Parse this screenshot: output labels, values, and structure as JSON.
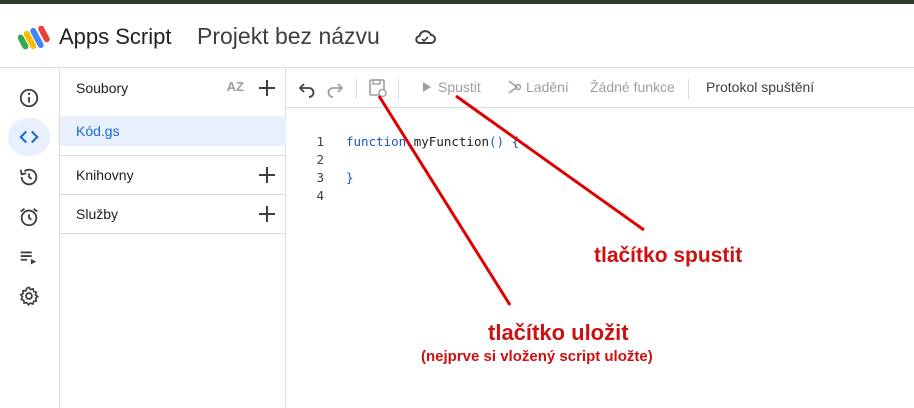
{
  "header": {
    "app_name": "Apps Script",
    "project_name": "Projekt bez názvu"
  },
  "files_panel": {
    "files_label": "Soubory",
    "sort_icon_text": "AZ",
    "file_name": "Kód.gs",
    "libraries_label": "Knihovny",
    "services_label": "Služby"
  },
  "toolbar": {
    "run_label": "Spustit",
    "debug_label": "Ladění",
    "function_select": "Žádné funkce",
    "execution_log_label": "Protokol spuštění"
  },
  "editor": {
    "line_numbers": [
      "1",
      "2",
      "3",
      "4"
    ],
    "keyword": "function",
    "function_name": "myFunction",
    "parens": "()",
    "open_brace": "{",
    "close_brace": "}"
  },
  "annotations": {
    "run_button_note": "tlačítko spustit",
    "save_button_note": "tlačítko uložit",
    "save_button_subnote": "(nejprve si vložený script uložte)",
    "color": "#cc1111"
  },
  "colors": {
    "accent": "#1967d2",
    "active_bg": "#e8f0fe"
  }
}
